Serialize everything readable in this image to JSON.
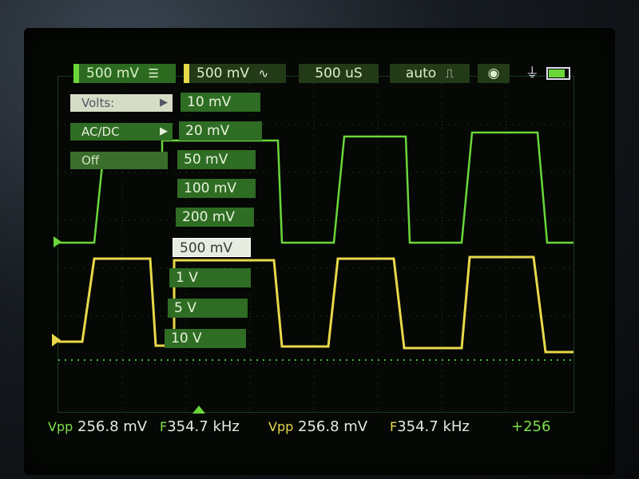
{
  "topbar": {
    "ch1_volts": "500 mV",
    "ch1_coupling_icon": "dc-coupling-icon",
    "ch2_volts": "500 mV",
    "ch2_coupling_icon": "ac-coupling-icon",
    "timebase": "500 uS",
    "trigger_mode": "auto",
    "trigger_icon": "rising-edge-icon",
    "camera_icon": "camera-icon",
    "usb_icon": "usb-plug-icon",
    "battery_icon": "battery-icon"
  },
  "channel_menu": {
    "items": [
      {
        "label": "Volts",
        "has_submenu": true
      },
      {
        "label": "AC/DC",
        "has_submenu": true
      },
      {
        "label": "Off",
        "has_submenu": false
      }
    ]
  },
  "volts_submenu": {
    "options": [
      "10 mV",
      "20 mV",
      "50 mV",
      "100 mV",
      "200 mV",
      "500 mV",
      "1 V",
      "5 V",
      "10 V"
    ],
    "selected": "500 mV"
  },
  "readouts": {
    "ch1_vpp_label": "Vpp",
    "ch1_vpp_value": "256.8 mV",
    "ch1_freq_label": "F",
    "ch1_freq_value": "354.7 kHz",
    "ch2_vpp_label": "Vpp",
    "ch2_vpp_value": "256.8 mV",
    "ch2_freq_label": "F",
    "ch2_freq_value": "354.7 kHz",
    "extra_value": "+256"
  },
  "colors": {
    "ch1": "#6bd63a",
    "ch2": "#e8d84a",
    "menu_bg": "#2f6c24",
    "selected_bg": "#e6ece0"
  }
}
